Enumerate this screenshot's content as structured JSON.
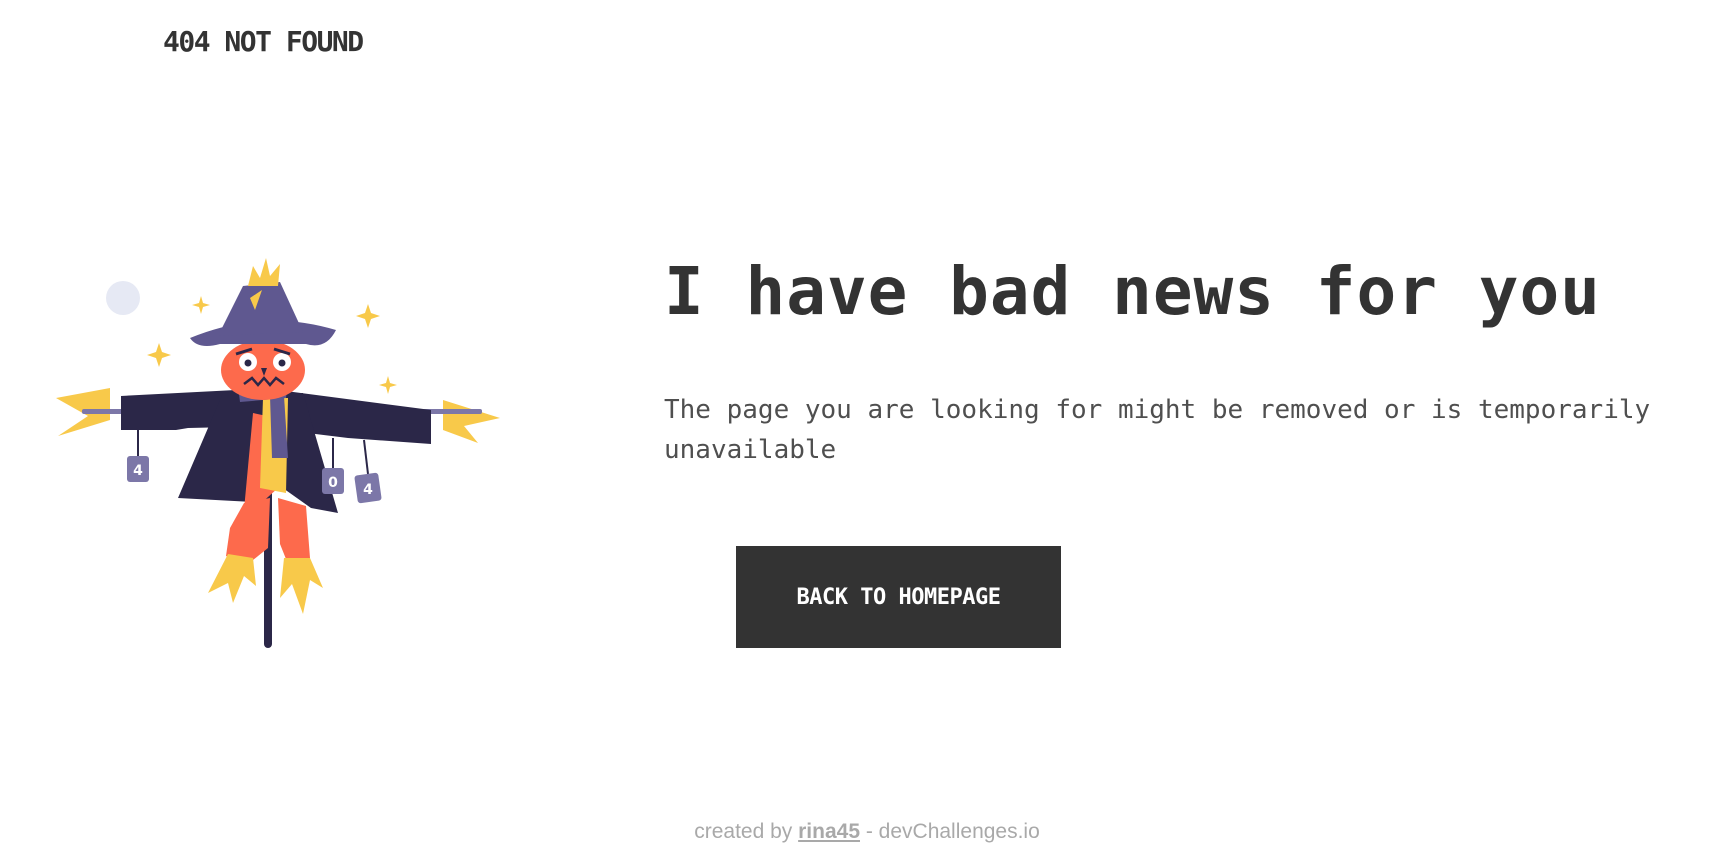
{
  "header": {
    "brand": "404 NOT FOUND"
  },
  "main": {
    "headline": "I have bad news for you",
    "message": "The page you are looking for might be removed or is temporarily unavailable",
    "button_label": "BACK TO HOMEPAGE"
  },
  "illustration": {
    "name": "scarecrow-illustration",
    "can_labels": [
      "4",
      "0",
      "4"
    ],
    "colors": {
      "coat": "#2b2748",
      "hat": "#5f5890",
      "face": "#fd6a4c",
      "straw": "#f8c94a",
      "cans": "#7c77a8",
      "moon": "#e6e9f4"
    }
  },
  "footer": {
    "prefix": "created by",
    "author": "rina45",
    "suffix": "- devChallenges.io"
  },
  "colors": {
    "text": "#333333",
    "button_bg": "#333333",
    "button_text": "#ffffff",
    "footer_text": "#a9a9a9"
  }
}
